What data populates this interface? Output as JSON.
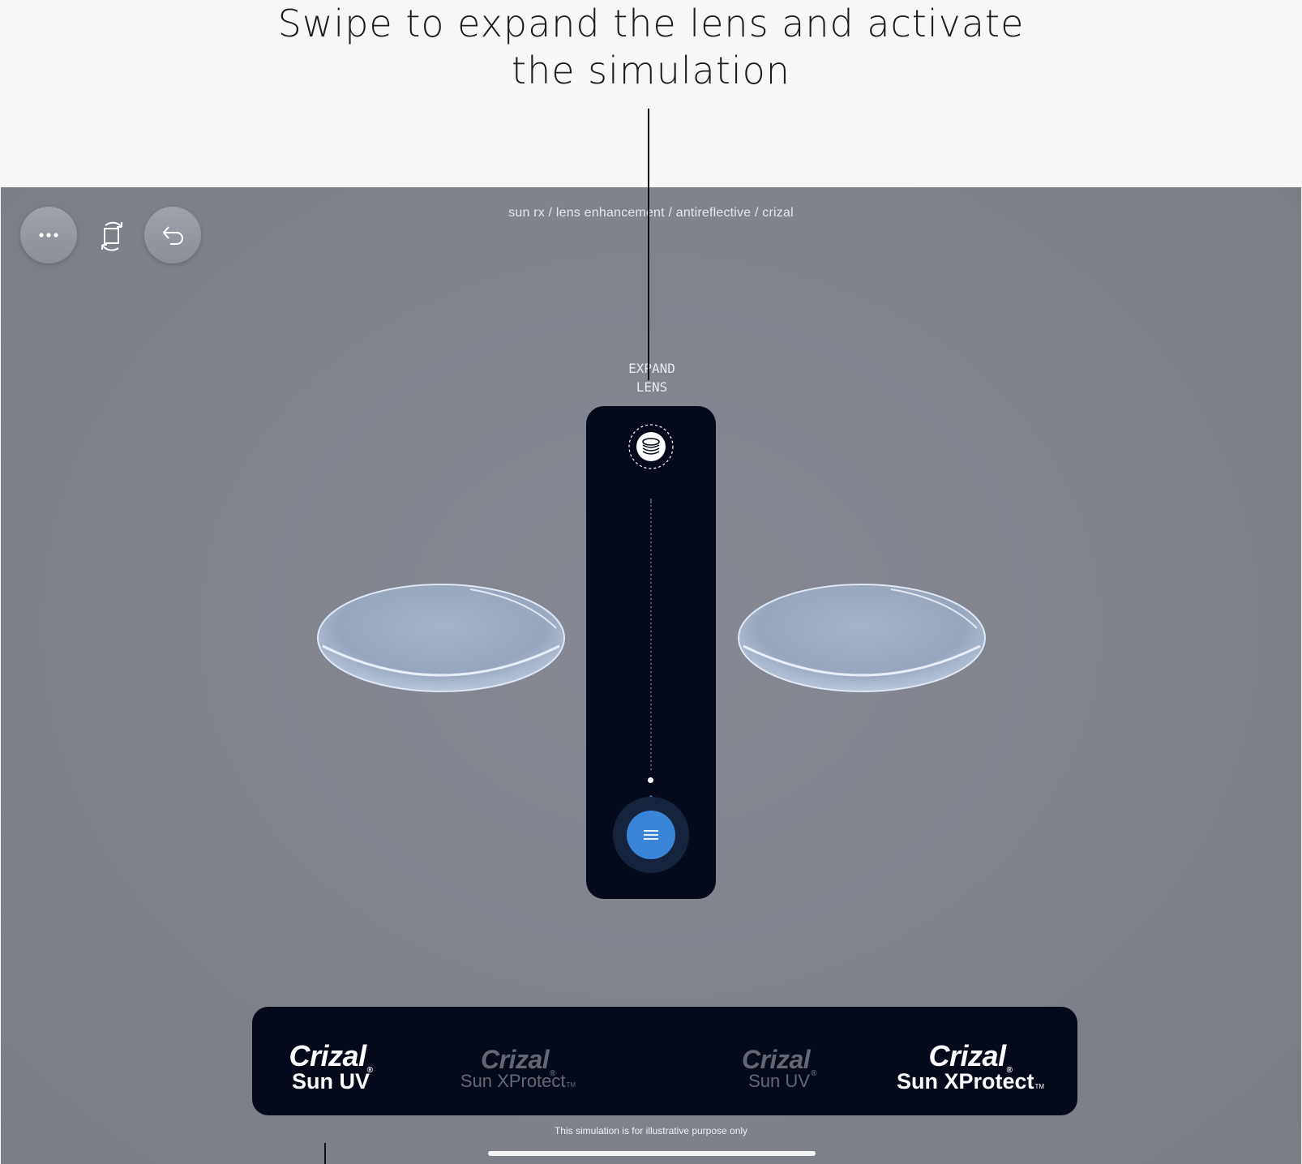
{
  "callout": {
    "line1": "Swipe to expand the lens and activate",
    "line2": "the simulation"
  },
  "toolbar": {
    "more_icon": "ellipsis-icon",
    "rotate_icon": "rotate-view-icon",
    "undo_icon": "undo-arrow-icon"
  },
  "breadcrumb": "sun rx / lens enhancement / antireflective / crizal",
  "slider": {
    "label_line1": "EXPAND",
    "label_line2": "LENS",
    "top_icon": "layers-icon",
    "handle_icon": "menu-lines-icon",
    "accent_color": "#3b85d8",
    "panel_color": "#050a1a"
  },
  "brands": [
    {
      "logo": "Crizal",
      "product": "Sun UV",
      "tm": "",
      "active": true
    },
    {
      "logo": "Crizal",
      "product": "Sun XProtect",
      "tm": "TM",
      "active": false
    },
    {
      "logo": "Crizal",
      "product": "Sun UV",
      "tm": "",
      "active": false
    },
    {
      "logo": "Crizal",
      "product": "Sun XProtect",
      "tm": "TM",
      "active": true
    }
  ],
  "disclaimer": "This simulation is for illustrative purpose only"
}
